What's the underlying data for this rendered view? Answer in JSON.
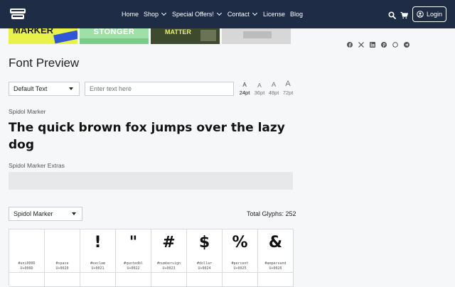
{
  "header": {
    "nav": [
      {
        "label": "Home",
        "dropdown": false
      },
      {
        "label": "Shop",
        "dropdown": true
      },
      {
        "label": "Special Offers!",
        "dropdown": true
      },
      {
        "label": "Contact",
        "dropdown": true
      },
      {
        "label": "License",
        "dropdown": false
      },
      {
        "label": "Blog",
        "dropdown": false
      }
    ],
    "login_label": "Login",
    "icons": [
      "search-icon",
      "cart-icon",
      "user-icon"
    ],
    "bg_color": "#1e2d45"
  },
  "thumbnails": [
    {
      "text": "MARKER",
      "bg": "#e8f24a"
    },
    {
      "text": "STONGER",
      "bg": "#9fe0a8"
    },
    {
      "text": "MATTER",
      "bg": "#3e4a2e"
    },
    {
      "text": "",
      "bg": "#d7d7d7"
    }
  ],
  "share_icons": [
    "facebook-icon",
    "x-icon",
    "linkedin-icon",
    "pinterest-icon",
    "whatsapp-icon",
    "telegram-icon"
  ],
  "preview": {
    "title": "Font Preview",
    "mode_select": "Default Text",
    "text_placeholder": "Enter text here",
    "sizes": [
      {
        "glyph": "A",
        "label": "24pt"
      },
      {
        "glyph": "A",
        "label": "36pt"
      },
      {
        "glyph": "A",
        "label": "48pt"
      },
      {
        "glyph": "A",
        "label": "72pt"
      }
    ],
    "font_name": "Spidol Marker",
    "sample": "The quick brown fox jumps over the lazy dog",
    "extras_name": "Spidol Marker Extras"
  },
  "glyphs": {
    "font_select": "Spidol Marker",
    "total_label": "Total Glyphs: 252",
    "cells": [
      {
        "glyph": "",
        "name": "#uni000D",
        "code": "U+000D"
      },
      {
        "glyph": "",
        "name": "#space",
        "code": "U+0020"
      },
      {
        "glyph": "!",
        "name": "#exclam",
        "code": "U+0021"
      },
      {
        "glyph": "\"",
        "name": "#quotedbl",
        "code": "U+0022"
      },
      {
        "glyph": "#",
        "name": "#numbersign",
        "code": "U+0023"
      },
      {
        "glyph": "$",
        "name": "#dollar",
        "code": "U+0024"
      },
      {
        "glyph": "%",
        "name": "#percent",
        "code": "U+0025"
      },
      {
        "glyph": "&",
        "name": "#ampersand",
        "code": "U+0026"
      }
    ]
  }
}
